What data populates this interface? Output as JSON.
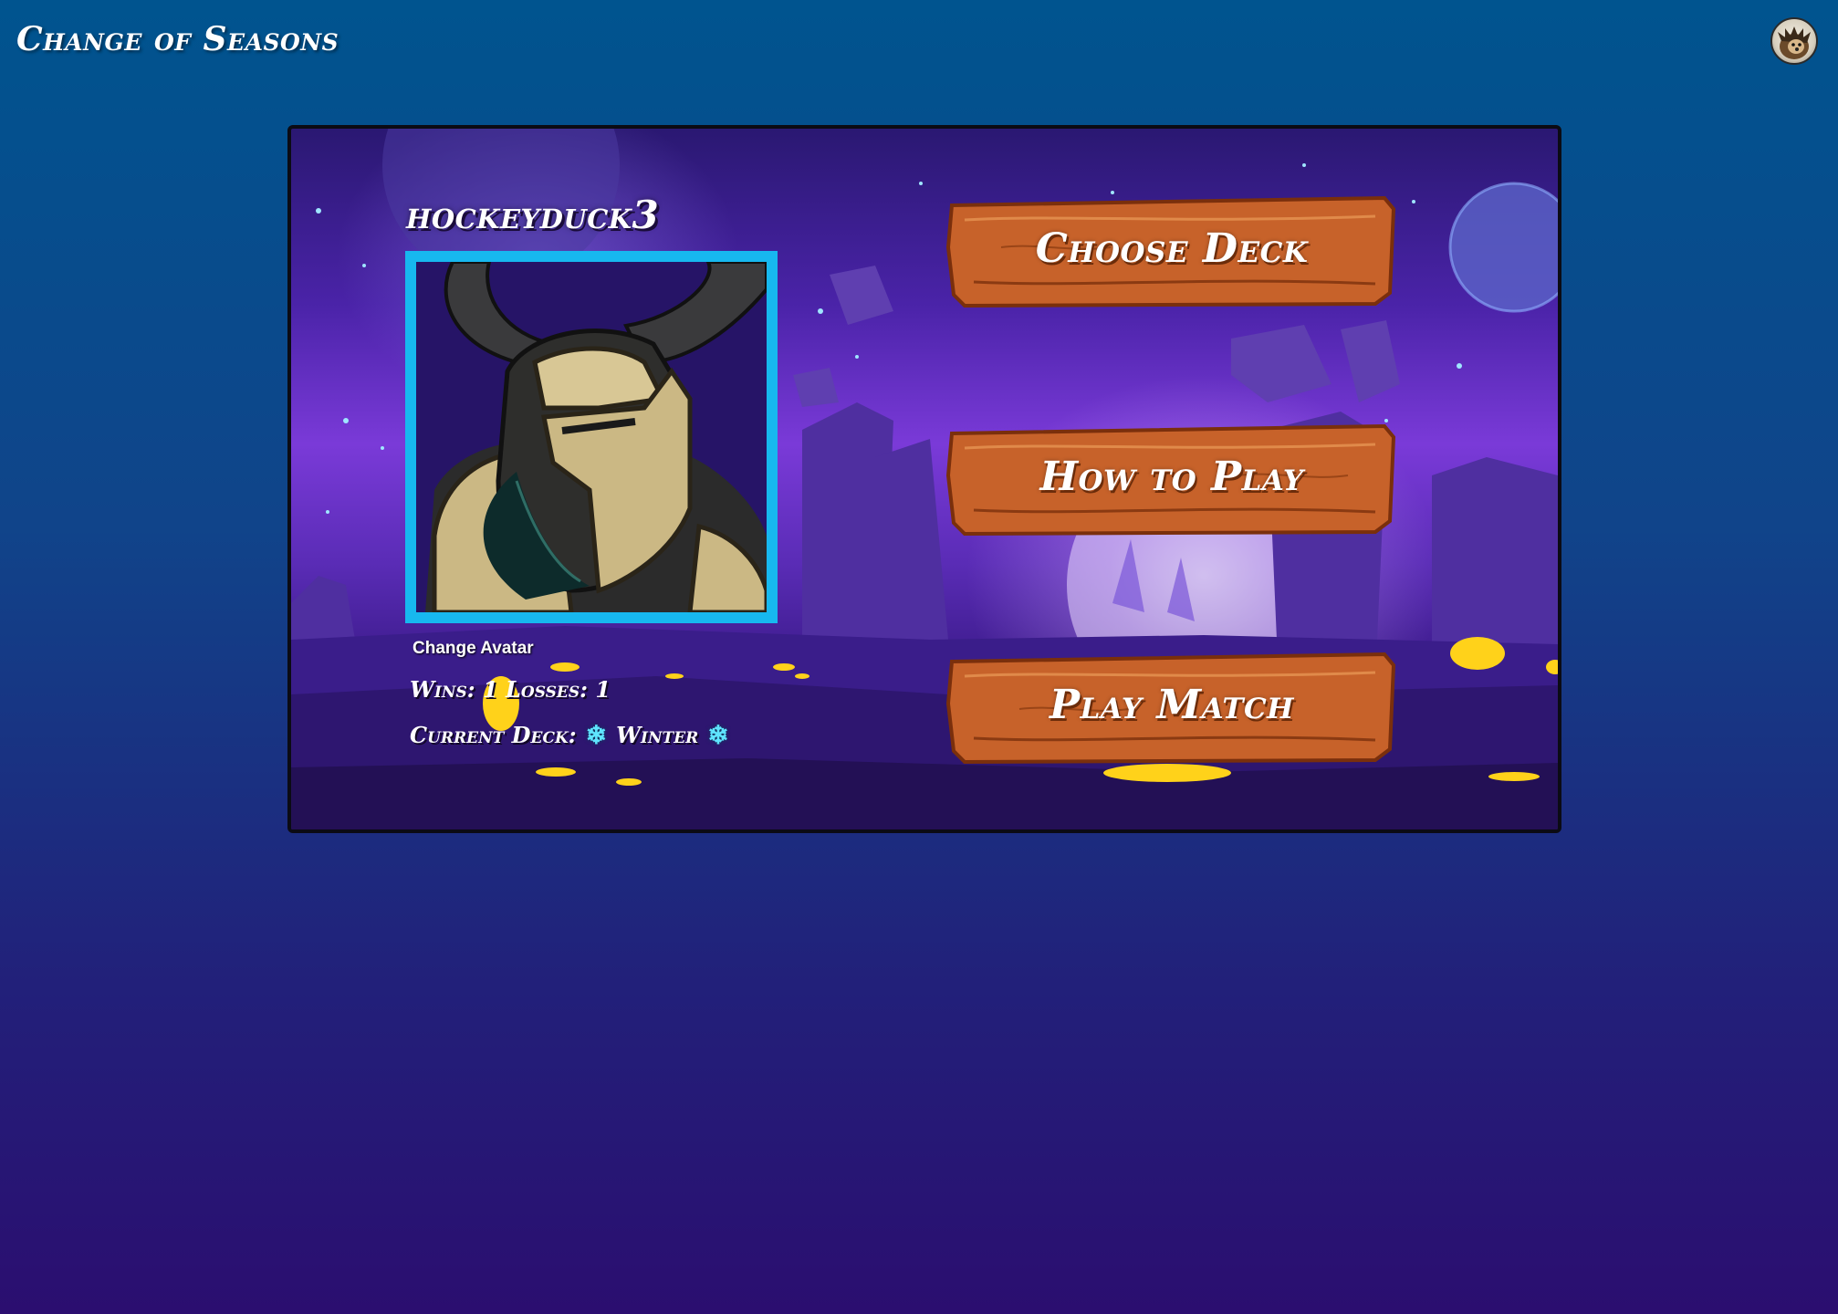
{
  "header": {
    "app_title": "Change of Seasons",
    "profile_icon": "hedgehog-avatar-icon"
  },
  "player": {
    "username": "hockeyduck3",
    "avatar_icon": "horned-knight-helmet-icon",
    "change_avatar_label": "Change Avatar",
    "wins_label": "Wins:",
    "wins": "1",
    "losses_label": "Losses:",
    "losses": "1",
    "current_deck_label": "Current Deck:",
    "current_deck": "Winter",
    "deck_icon": "snowflake-icon"
  },
  "menu": {
    "choose_deck_label": "Choose Deck",
    "how_to_play_label": "How to Play",
    "play_match_label": "Play Match"
  },
  "colors": {
    "avatar_border": "#17b8ef",
    "wood": "#c7622a",
    "snowflake": "#5fe4ff"
  }
}
